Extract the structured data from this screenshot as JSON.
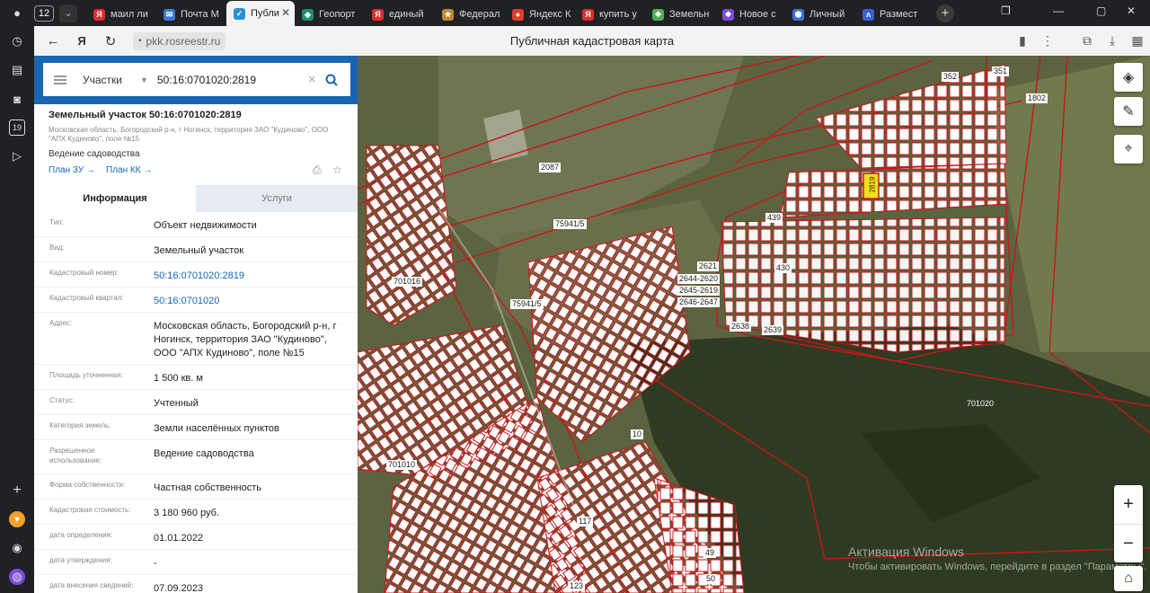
{
  "browser": {
    "tab_count": "12",
    "tabs": [
      {
        "label": "маил ли",
        "color": "#e32b2b",
        "glyph": "Я"
      },
      {
        "label": "Почта М",
        "color": "#3a78d8",
        "glyph": "✉"
      },
      {
        "label": "Публи",
        "color": "#2a8fd6",
        "glyph": "✓"
      },
      {
        "label": "Геопорт",
        "color": "#1a8f6a",
        "glyph": "◆"
      },
      {
        "label": "единый",
        "color": "#e32b2b",
        "glyph": "Я"
      },
      {
        "label": "Федерал",
        "color": "#b98b2b",
        "glyph": "★"
      },
      {
        "label": "Яндекс К",
        "color": "#e33b2b",
        "glyph": "●"
      },
      {
        "label": "купить у",
        "color": "#e32b2b",
        "glyph": "Я"
      },
      {
        "label": "Земельн",
        "color": "#4caf50",
        "glyph": "❖"
      },
      {
        "label": "Новое с",
        "color": "#7b4be0",
        "glyph": "❖"
      },
      {
        "label": "Личный",
        "color": "#3a6fd8",
        "glyph": "⬢"
      },
      {
        "label": "Размест",
        "color": "#3a5fd8",
        "glyph": "ʌ"
      }
    ],
    "url": "pkk.rosreestr.ru",
    "page_title": "Публичная кадастровая карта"
  },
  "search": {
    "category": "Участки",
    "query": "50:16:0701020:2819"
  },
  "object": {
    "title": "Земельный участок 50:16:0701020:2819",
    "address_short": "Московская область, Богородский р-н, г Ногинск, территория ЗАО \"Кудиново\", ООО \"АПХ Кудиново\", поле №15",
    "use": "Ведение садоводства",
    "plan_zu": "План ЗУ →",
    "plan_kk": "План КК →"
  },
  "panel_tabs": {
    "info": "Информация",
    "services": "Услуги"
  },
  "attributes": [
    {
      "label": "Тип:",
      "value": "Объект недвижимости",
      "link": false
    },
    {
      "label": "Вид:",
      "value": "Земельный участок",
      "link": false
    },
    {
      "label": "Кадастровый номер:",
      "value": "50:16:0701020:2819",
      "link": true
    },
    {
      "label": "Кадастровый квартал:",
      "value": "50:16:0701020",
      "link": true
    },
    {
      "label": "Адрес:",
      "value": "Московская область, Богородский р-н, г Ногинск, территория ЗАО \"Кудиново\", ООО \"АПХ Кудиново\", поле №15",
      "link": false
    },
    {
      "label": "Площадь уточненная:",
      "value": "1 500 кв. м",
      "link": false
    },
    {
      "label": "Статус:",
      "value": "Учтенный",
      "link": false
    },
    {
      "label": "Категория земель:",
      "value": "Земли населённых пунктов",
      "link": false
    },
    {
      "label": "Разрешенное использование:",
      "value": "Ведение садоводства",
      "link": false
    },
    {
      "label": "Форма собственности:",
      "value": "Частная собственность",
      "link": false
    },
    {
      "label": "Кадастровая стоимость:",
      "value": "3 180 960 руб.",
      "link": false
    },
    {
      "label": "дата определения:",
      "value": "01.01.2022",
      "link": false
    },
    {
      "label": "дата утверждения:",
      "value": "-",
      "link": false
    },
    {
      "label": "дата внесения сведений:",
      "value": "07.09.2023",
      "link": false
    }
  ],
  "map": {
    "labels": [
      "352",
      "351",
      "1802",
      "2087",
      "75941/5",
      "75941/5",
      "701016",
      "701020",
      "701010",
      "439",
      "430",
      "2621",
      "2644-2620",
      "2645-2619",
      "2646-2647",
      "2638",
      "2639",
      "2819",
      "10",
      "49",
      "50",
      "123",
      "117"
    ],
    "watermark_title": "Активация Windows",
    "watermark_sub": "Чтобы активировать Windows, перейдите в раздел \"Параметры\"."
  }
}
